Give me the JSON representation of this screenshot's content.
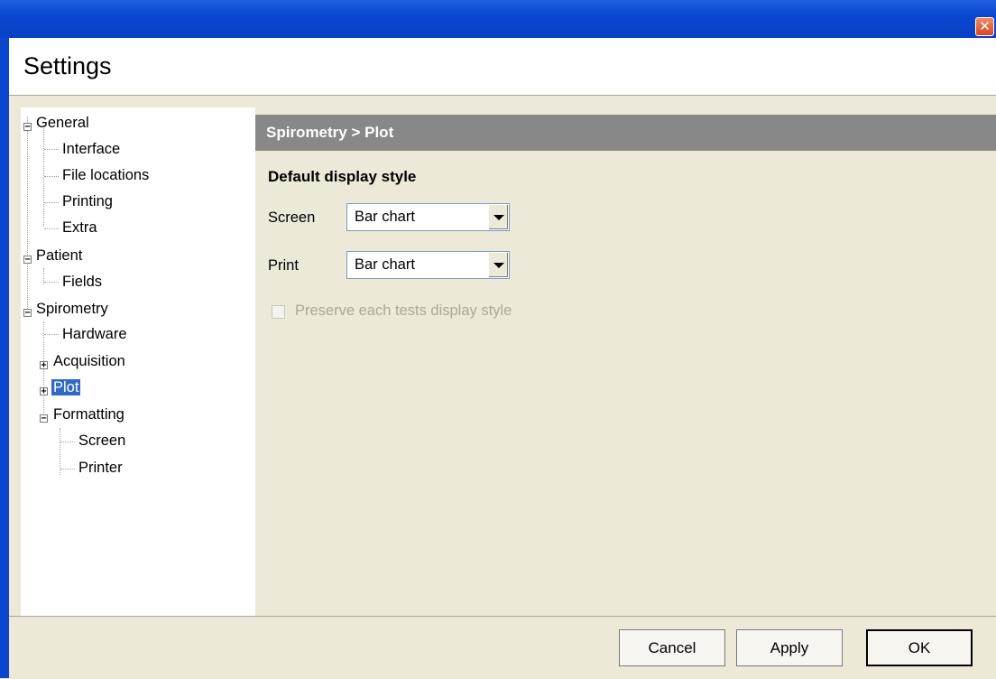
{
  "window": {
    "title": "Settings",
    "close_icon": "close-icon"
  },
  "tree": {
    "nodes": [
      {
        "label": "General",
        "expander": "minus"
      },
      {
        "label": "Interface"
      },
      {
        "label": "File locations"
      },
      {
        "label": "Printing"
      },
      {
        "label": "Extra"
      },
      {
        "label": "Patient",
        "expander": "minus"
      },
      {
        "label": "Fields"
      },
      {
        "label": "Spirometry",
        "expander": "minus"
      },
      {
        "label": "Hardware"
      },
      {
        "label": "Acquisition",
        "expander": "plus"
      },
      {
        "label": "Plot",
        "expander": "plus",
        "selected": true
      },
      {
        "label": "Formatting",
        "expander": "minus"
      },
      {
        "label": "Screen"
      },
      {
        "label": "Printer"
      }
    ]
  },
  "panel": {
    "breadcrumb": "Spirometry > Plot",
    "section_title": "Default display style",
    "screen_label": "Screen",
    "screen_value": "Bar chart",
    "print_label": "Print",
    "print_value": "Bar chart",
    "preserve_label": "Preserve each tests display style",
    "preserve_checked": false,
    "preserve_enabled": false
  },
  "buttons": {
    "cancel": "Cancel",
    "apply": "Apply",
    "ok": "OK"
  },
  "colors": {
    "titlebar": "#0a46d0",
    "selection": "#316ac5",
    "panel_header": "#888888"
  }
}
